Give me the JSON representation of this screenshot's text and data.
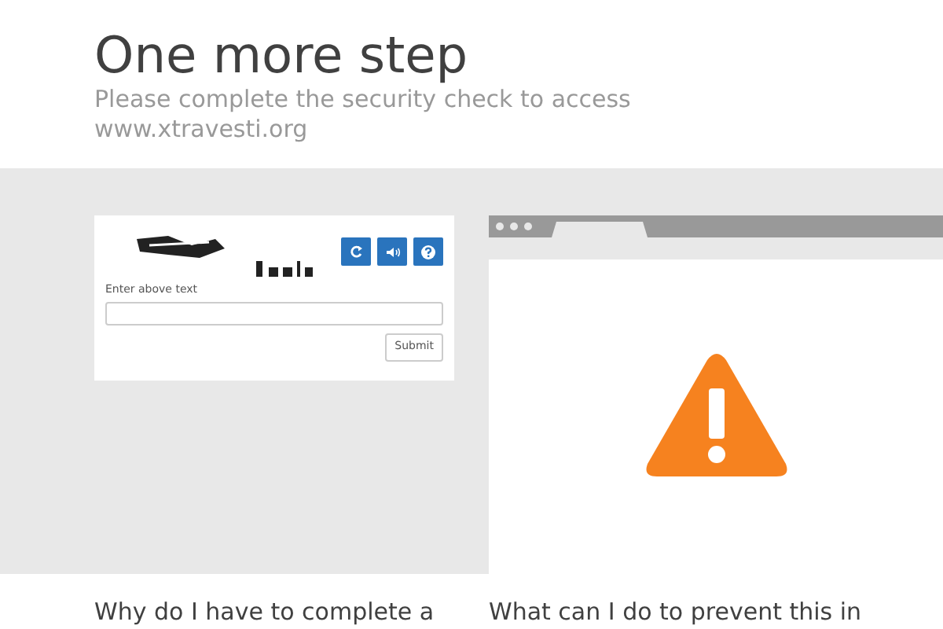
{
  "header": {
    "title": "One more step",
    "subtitle": "Please complete the security check to access www.xtravesti.org"
  },
  "captcha": {
    "buttons": [
      {
        "kind": "refresh"
      },
      {
        "kind": "audio"
      },
      {
        "kind": "help"
      }
    ],
    "field_label": "Enter above text",
    "submit": "Submit"
  },
  "sections": [
    {
      "heading": "Why do I have to complete a"
    },
    {
      "heading": "What can I do to prevent this in"
    }
  ]
}
